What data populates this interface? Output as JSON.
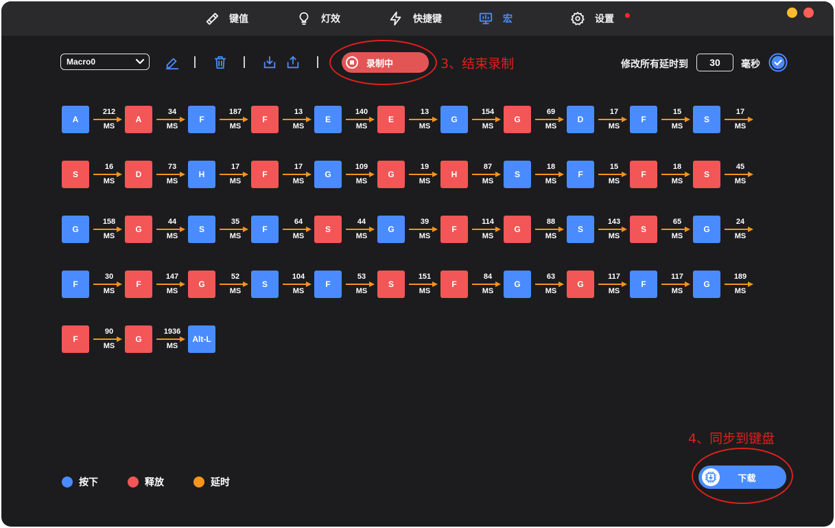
{
  "nav": {
    "items": [
      {
        "label": "键值",
        "icon": "key-icon"
      },
      {
        "label": "灯效",
        "icon": "bulb-icon"
      },
      {
        "label": "快捷键",
        "icon": "lightning-icon"
      },
      {
        "label": "宏",
        "icon": "monitor-icon",
        "active": true
      },
      {
        "label": "设置",
        "icon": "gear-icon"
      }
    ]
  },
  "window_controls": {
    "minimize_color": "#febc2e",
    "close_color": "#ff5f57"
  },
  "toolbar": {
    "macro_name": "Macro0",
    "record_label": "录制中",
    "delay_all_label": "修改所有延时到",
    "delay_value": "30",
    "delay_unit": "毫秒"
  },
  "annotations": {
    "step3": "3、结束录制",
    "step4": "4、同步到键盘"
  },
  "macro": {
    "unit": "MS",
    "rows": [
      [
        [
          "A",
          "down"
        ],
        212,
        [
          "A",
          "up"
        ],
        34,
        [
          "F",
          "down"
        ],
        187,
        [
          "F",
          "up"
        ],
        13,
        [
          "E",
          "down"
        ],
        140,
        [
          "E",
          "up"
        ],
        13,
        [
          "G",
          "down"
        ],
        154,
        [
          "G",
          "up"
        ],
        69,
        [
          "D",
          "down"
        ],
        17,
        [
          "F",
          "down"
        ],
        15,
        [
          "S",
          "down"
        ],
        17
      ],
      [
        [
          "S",
          "up"
        ],
        16,
        [
          "D",
          "up"
        ],
        73,
        [
          "H",
          "down"
        ],
        17,
        [
          "F",
          "up"
        ],
        17,
        [
          "G",
          "down"
        ],
        109,
        [
          "G",
          "up"
        ],
        19,
        [
          "H",
          "up"
        ],
        87,
        [
          "S",
          "down"
        ],
        18,
        [
          "F",
          "down"
        ],
        15,
        [
          "F",
          "up"
        ],
        18,
        [
          "S",
          "up"
        ],
        45
      ],
      [
        [
          "G",
          "down"
        ],
        158,
        [
          "G",
          "up"
        ],
        44,
        [
          "S",
          "down"
        ],
        35,
        [
          "F",
          "down"
        ],
        64,
        [
          "S",
          "up"
        ],
        44,
        [
          "G",
          "down"
        ],
        39,
        [
          "F",
          "up"
        ],
        114,
        [
          "G",
          "up"
        ],
        88,
        [
          "S",
          "down"
        ],
        143,
        [
          "S",
          "up"
        ],
        65,
        [
          "G",
          "down"
        ],
        24
      ],
      [
        [
          "F",
          "down"
        ],
        30,
        [
          "F",
          "up"
        ],
        147,
        [
          "G",
          "up"
        ],
        52,
        [
          "S",
          "down"
        ],
        104,
        [
          "F",
          "down"
        ],
        53,
        [
          "S",
          "up"
        ],
        151,
        [
          "F",
          "up"
        ],
        84,
        [
          "G",
          "down"
        ],
        63,
        [
          "G",
          "up"
        ],
        117,
        [
          "F",
          "down"
        ],
        117,
        [
          "G",
          "down"
        ],
        189
      ],
      [
        [
          "F",
          "up"
        ],
        90,
        [
          "G",
          "up"
        ],
        1936,
        [
          "Alt-L",
          "down"
        ]
      ]
    ]
  },
  "legend": [
    {
      "label": "按下",
      "color": "#4a8cff"
    },
    {
      "label": "释放",
      "color": "#f35656"
    },
    {
      "label": "延时",
      "color": "#f7941d"
    }
  ],
  "download": {
    "label": "下载"
  },
  "colors": {
    "accent": "#4a8cff",
    "release": "#f35656",
    "delay": "#f7941d",
    "annotation": "#e0201e"
  }
}
